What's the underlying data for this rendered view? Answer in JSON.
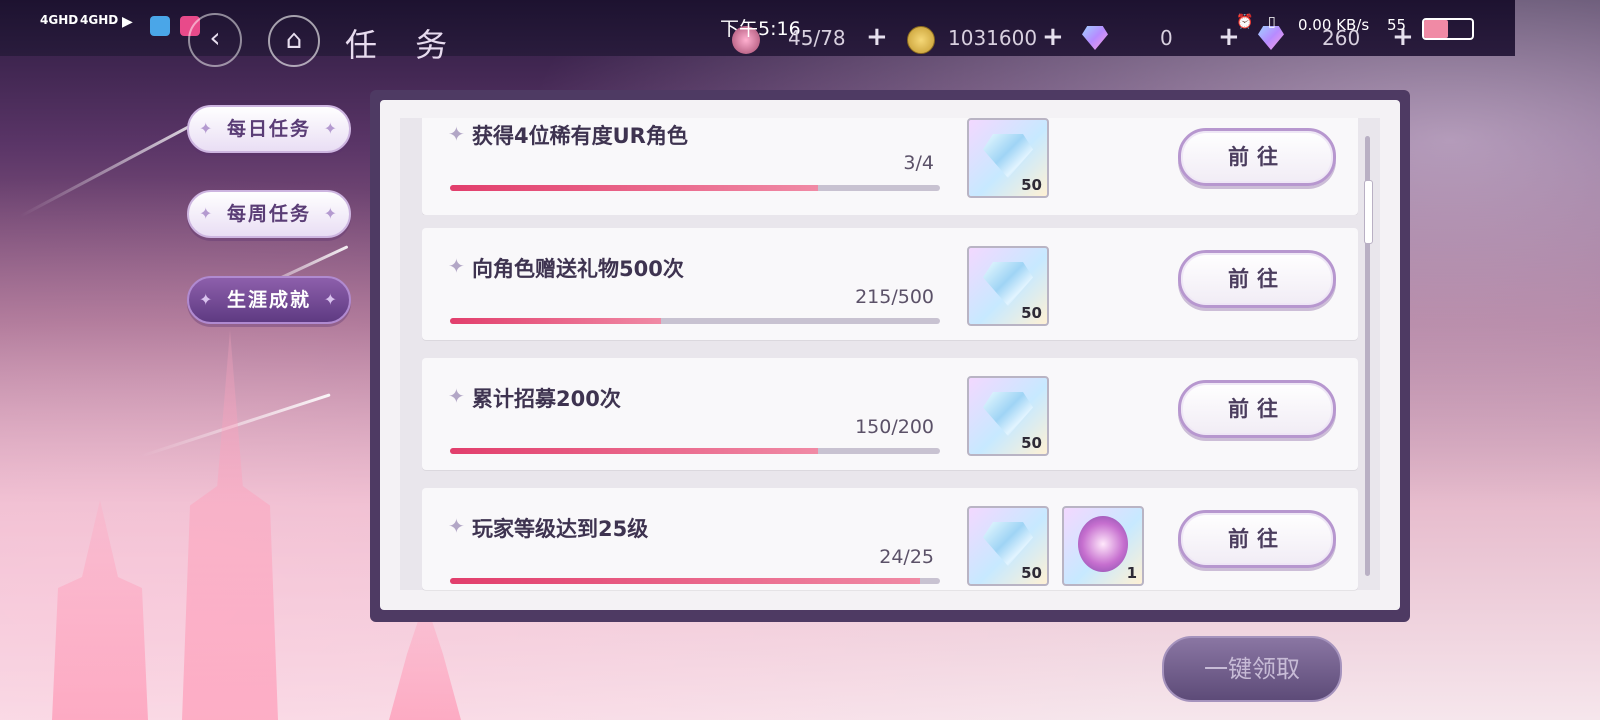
{
  "status_bar": {
    "network_1": "4GHD",
    "network_2": "4GHD",
    "time": "下午5:16",
    "speed": "0.00 KB/s",
    "battery": "55"
  },
  "header": {
    "title": "任 务",
    "stamina": "45/78",
    "gold": "1031600",
    "gems_a": "0",
    "gems_b": "260"
  },
  "side_tabs": [
    {
      "label": "每日任务",
      "active": false
    },
    {
      "label": "每周任务",
      "active": false
    },
    {
      "label": "生涯成就",
      "active": true
    }
  ],
  "tasks": [
    {
      "name": "获得4位稀有度UR角色",
      "progress_text": "3/4",
      "progress": 0.75,
      "rewards": [
        {
          "icon": "diamond-icon",
          "qty": "50"
        }
      ],
      "action": "前往"
    },
    {
      "name": "向角色赠送礼物500次",
      "progress_text": "215/500",
      "progress": 0.43,
      "rewards": [
        {
          "icon": "diamond-icon",
          "qty": "50"
        }
      ],
      "action": "前往"
    },
    {
      "name": "累计招募200次",
      "progress_text": "150/200",
      "progress": 0.75,
      "rewards": [
        {
          "icon": "diamond-icon",
          "qty": "50"
        }
      ],
      "action": "前往"
    },
    {
      "name": "玩家等级达到25级",
      "progress_text": "24/25",
      "progress": 0.96,
      "rewards": [
        {
          "icon": "diamond-icon",
          "qty": "50"
        },
        {
          "icon": "crystal-badge-icon",
          "qty": "1"
        }
      ],
      "action": "前往"
    }
  ],
  "claim_all_label": "一键领取"
}
